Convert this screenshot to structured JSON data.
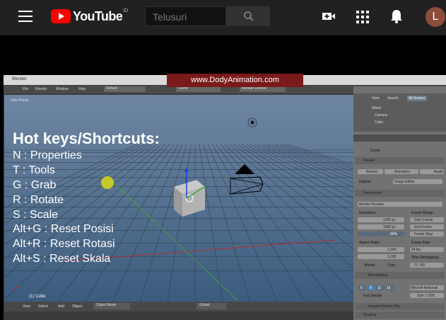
{
  "youtube": {
    "logo_text": "YouTube",
    "logo_sup": "ID",
    "search_placeholder": "Telusuri",
    "avatar_letter": "L",
    "icons": [
      "menu-icon",
      "search-icon",
      "create-video-icon",
      "apps-icon",
      "notifications-icon"
    ]
  },
  "video": {
    "banner": "www.DodyAnimation.com",
    "blender": {
      "window_title": "Blender",
      "menu": [
        "File",
        "Render",
        "Window",
        "Help"
      ],
      "layout": "Default",
      "scene": "Scene",
      "engine": "Blender Render",
      "viewport_label": "User Persp",
      "object_label": "(1) Cube",
      "bottom_bar": [
        "View",
        "Select",
        "Add",
        "Object",
        "Object Mode",
        "Global"
      ],
      "outliner": {
        "tabs": [
          "View",
          "Search",
          "All Scenes"
        ],
        "items": [
          "World",
          "Camera",
          "Cube"
        ]
      },
      "properties": {
        "scene_label": "Scene",
        "render_section": "Render",
        "render_buttons": [
          "Render",
          "Animation",
          "Audio"
        ],
        "display_label": "Display:",
        "display_value": "Image Editor",
        "dimensions_section": "Dimensions",
        "render_presets": "Render Presets",
        "resolution_label": "Resolution:",
        "res_x": "1920 px",
        "res_y": "1080 px",
        "res_pct": "50%",
        "frame_range_label": "Frame Range:",
        "start_frame": "Start Frame",
        "end_frame": "End Frame",
        "frame_step": "Frame Step",
        "aspect_label": "Aspect Ratio:",
        "aspect_x": "1.000",
        "aspect_y": "1.000",
        "frame_rate_label": "Frame Rate:",
        "fps": "24 fps",
        "time_remap": "Time Remapping:",
        "old": "O: 100",
        "border": "Border",
        "crop": "Crop",
        "anti_alias": "Anti-Aliasing",
        "aa_values": [
          "5",
          "8",
          "11",
          "16"
        ],
        "filter": "Mitchell-Netravali",
        "full_sample": "Full Sample",
        "size": "Size: 1.000",
        "sampled_motion": "Sampled Motion Blur",
        "shading": "Shading"
      }
    },
    "hotkeys": {
      "title": "Hot keys/Shortcuts:",
      "lines": [
        "N : Properties",
        "T : Tools",
        "G : Grab",
        "R : Rotate",
        "S : Scale",
        "Alt+G : Reset Posisi",
        "Alt+R : Reset Rotasi",
        "Alt+S : Reset Skala"
      ]
    }
  }
}
